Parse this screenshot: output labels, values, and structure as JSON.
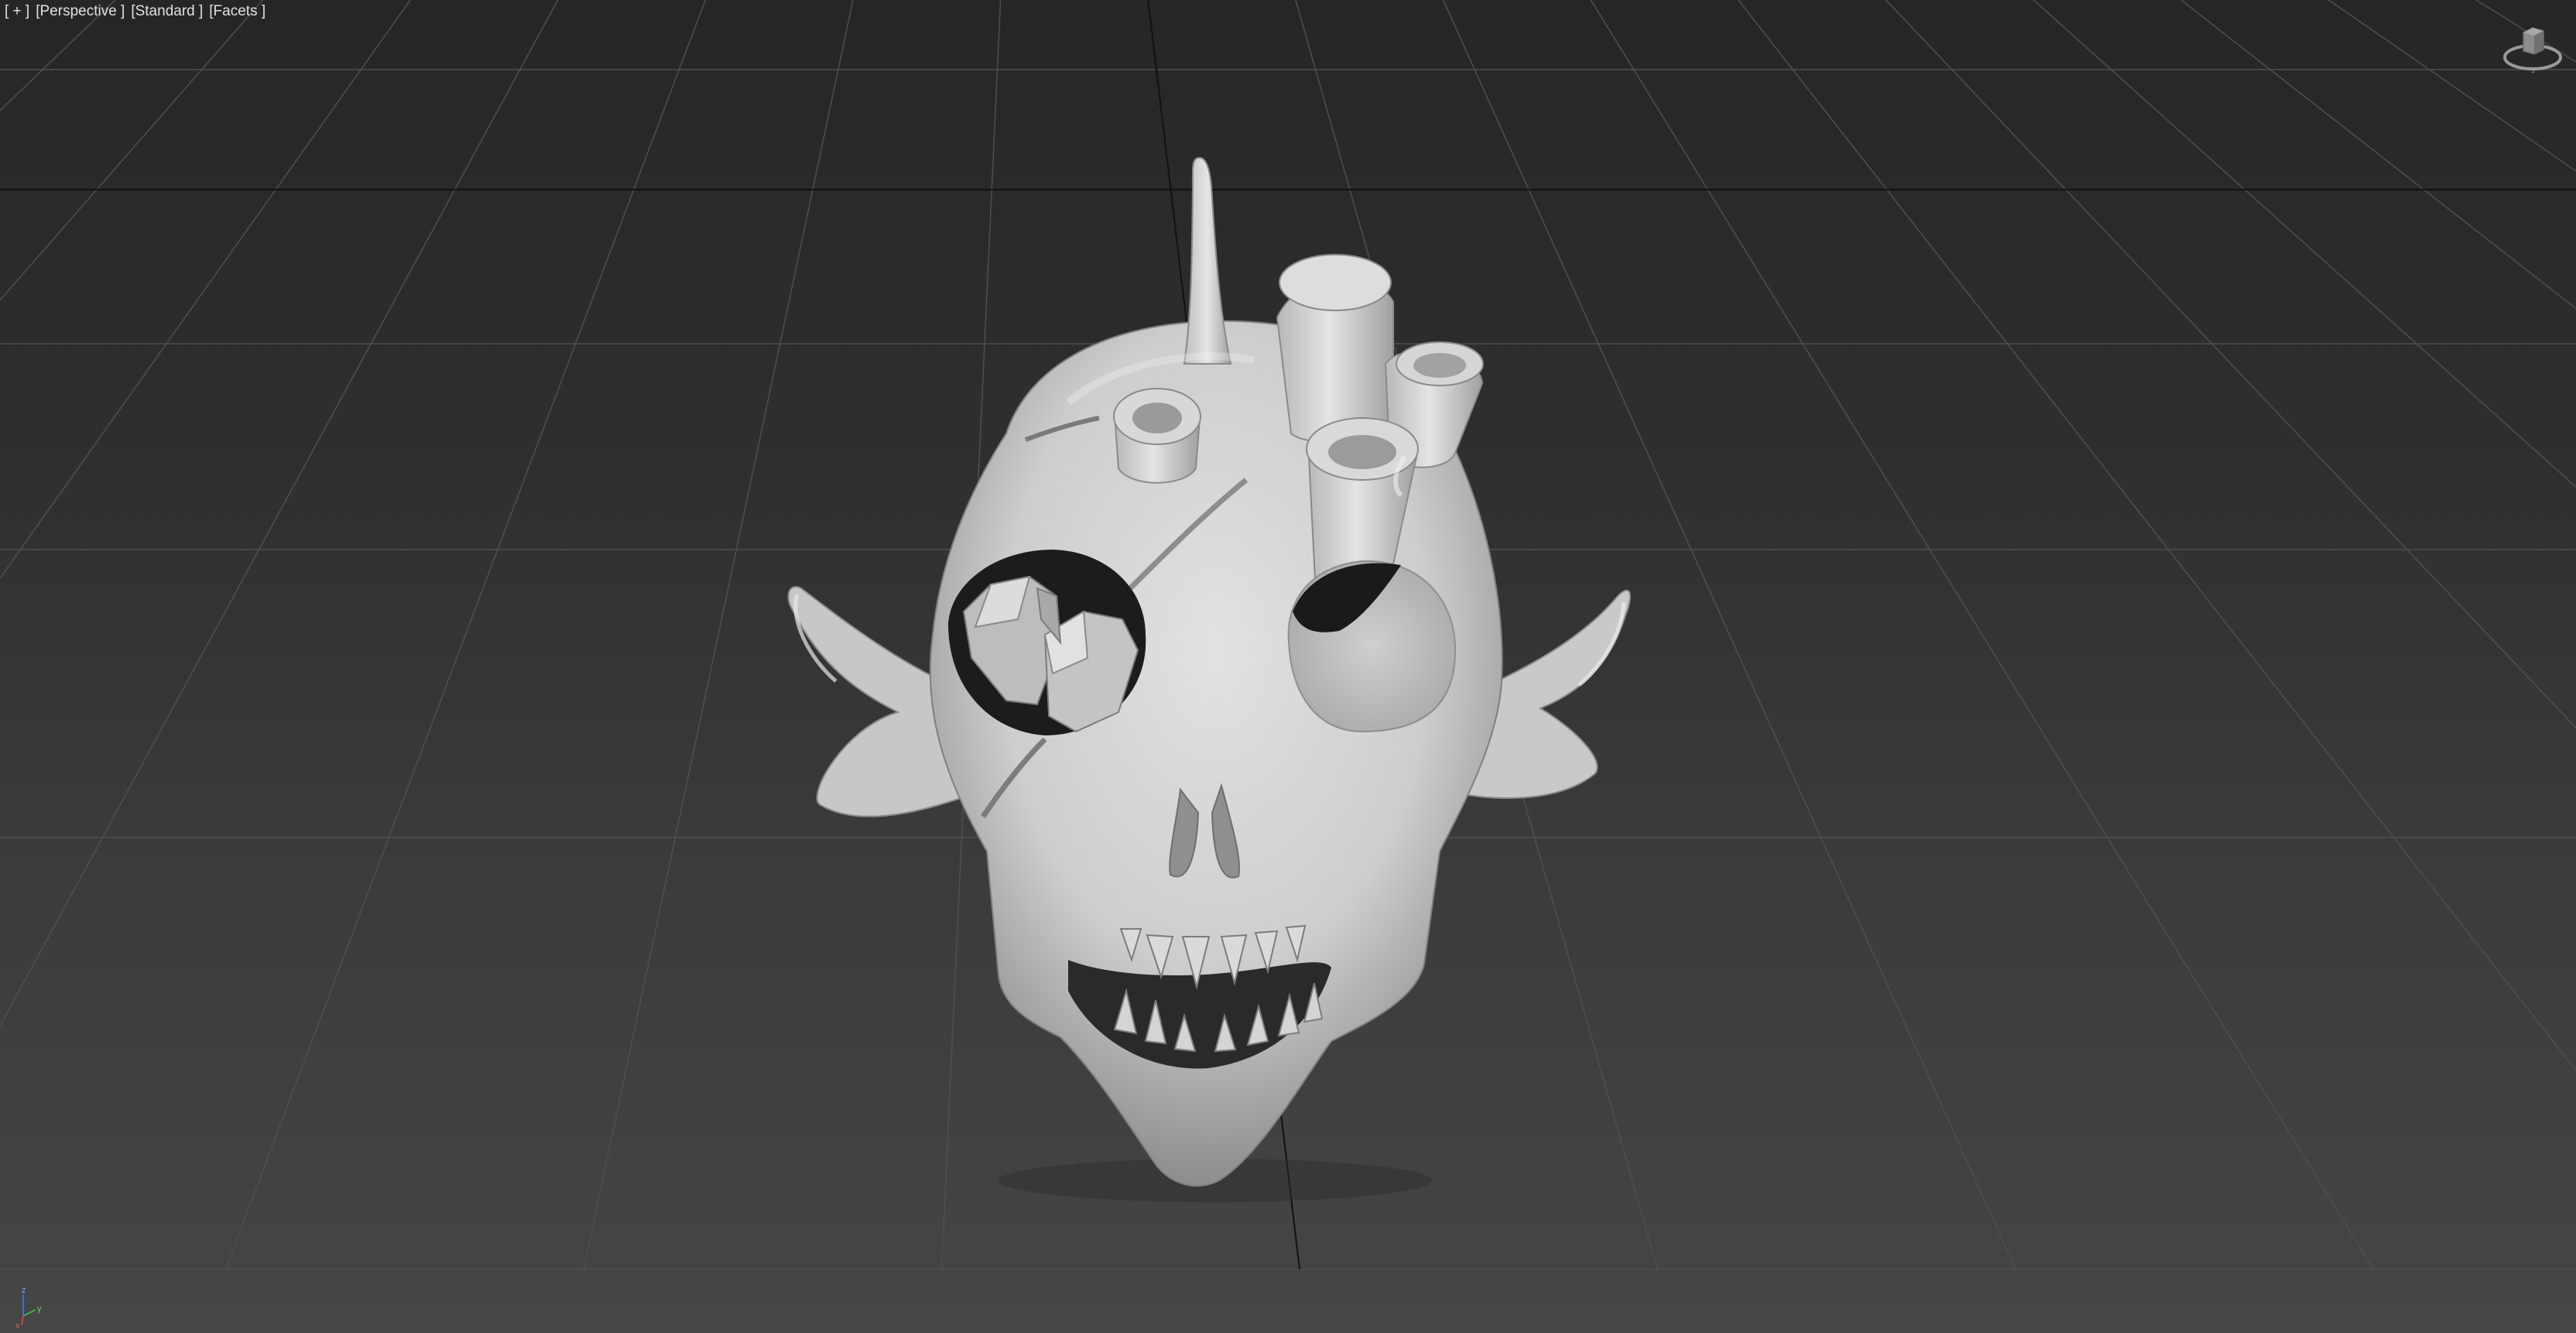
{
  "viewport": {
    "labels": [
      "[ + ]",
      "[Perspective ]",
      "[Standard ]",
      "[Facets ]"
    ],
    "background_color_top": "#262626",
    "background_color_bottom": "#464646",
    "grid_color": "#4f4f4f",
    "grid_axis_color": "#111111",
    "model_color": "#cfcfcf"
  },
  "viewcube": {
    "icon": "viewcube-icon",
    "compass_label": "S"
  },
  "axis_tripod": {
    "icon": "axis-tripod-icon",
    "x_label": "x",
    "y_label": "y",
    "z_label": "z"
  }
}
